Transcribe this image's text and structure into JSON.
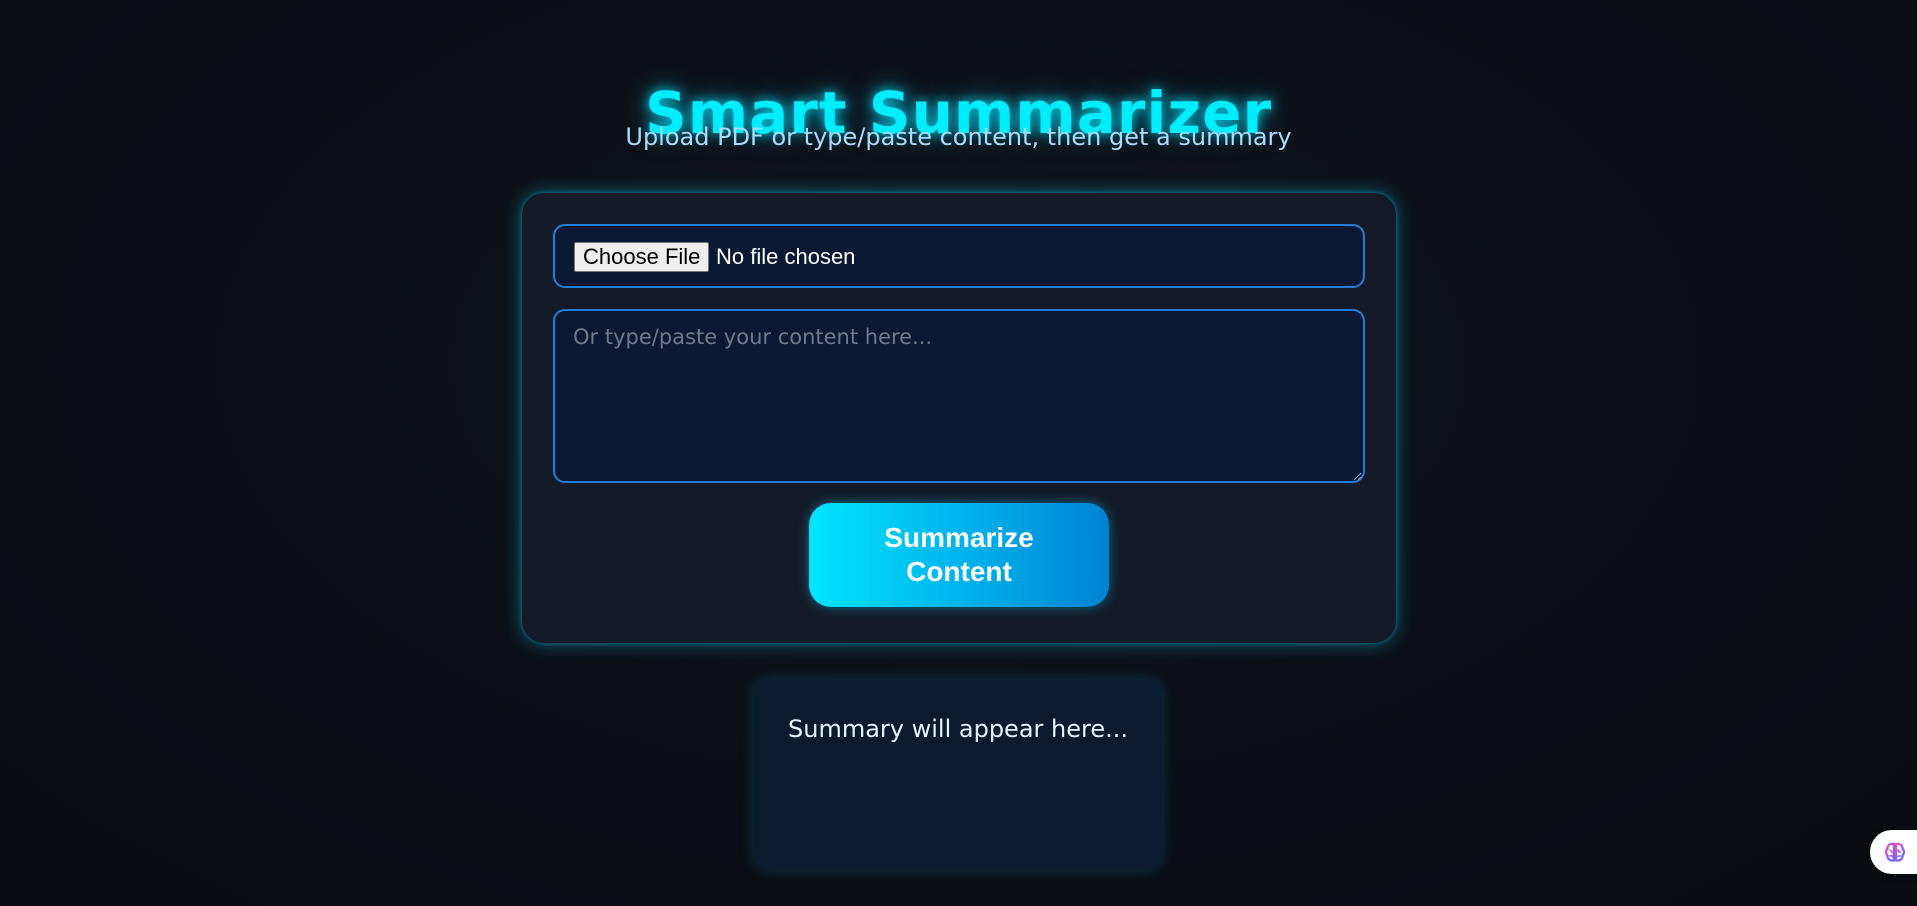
{
  "header": {
    "title": "Smart Summarizer",
    "subtitle": "Upload PDF or type/paste content, then get a summary"
  },
  "upload": {
    "button_label": "Choose File",
    "status": "No file chosen"
  },
  "content_input": {
    "placeholder": "Or type/paste your content here...",
    "value": ""
  },
  "summarize_button": {
    "label": "Summarize Content"
  },
  "summary": {
    "text": "Summary will appear here..."
  },
  "widget": {
    "icon": "brain-icon"
  },
  "colors": {
    "accent": "#00ecff",
    "background": "#0b0e14",
    "card": "#141a27",
    "input_border": "#1f7fd8",
    "button_start": "#00e5ff",
    "button_end": "#0082d2"
  }
}
